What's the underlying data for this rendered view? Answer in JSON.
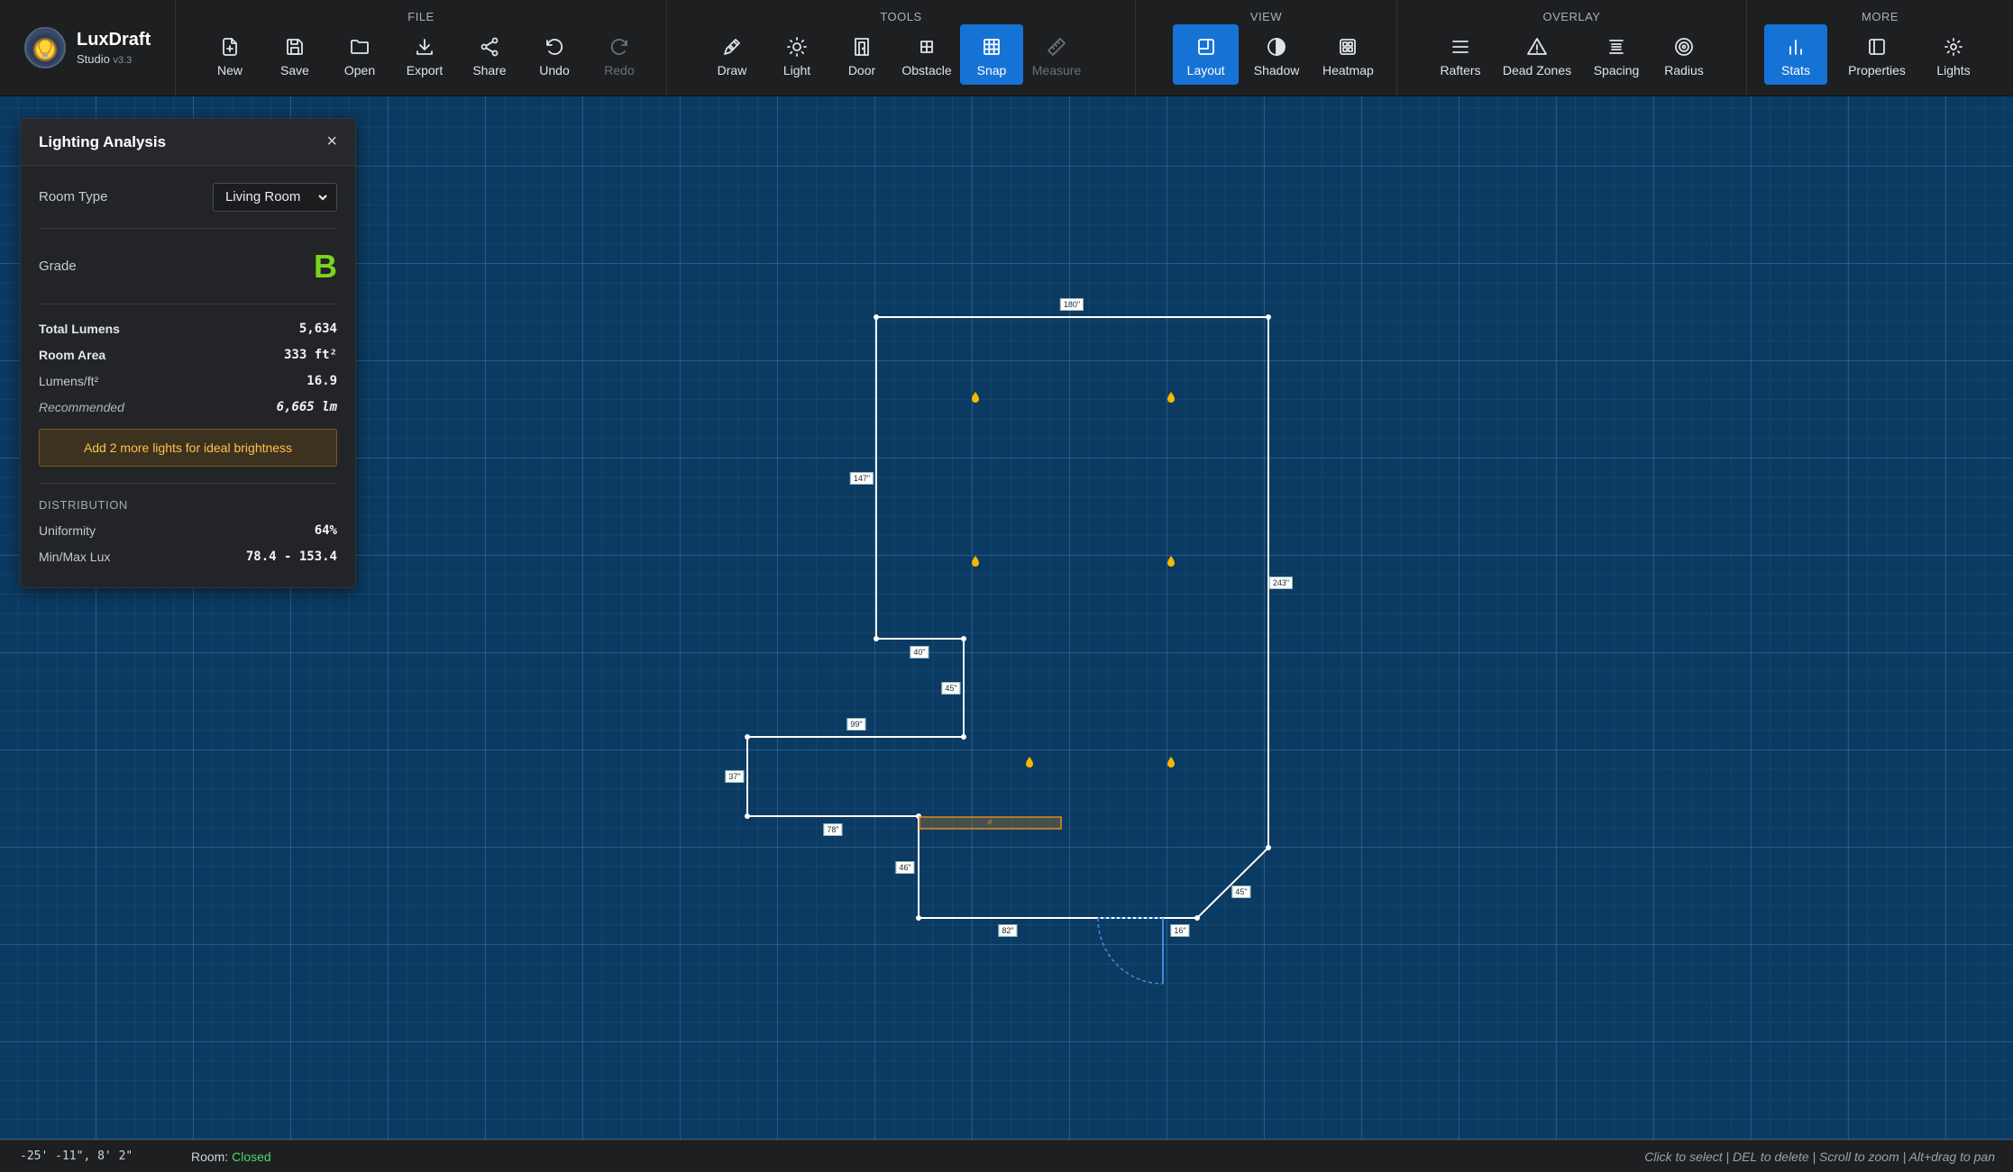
{
  "app": {
    "name": "LuxDraft",
    "subtitle": "Studio",
    "version": "v3.3"
  },
  "toolbar": {
    "groups": [
      {
        "label": "FILE",
        "buttons": [
          {
            "label": "New",
            "icon": "file-plus-icon",
            "state": "normal"
          },
          {
            "label": "Save",
            "icon": "save-icon",
            "state": "normal"
          },
          {
            "label": "Open",
            "icon": "folder-icon",
            "state": "normal"
          },
          {
            "label": "Export",
            "icon": "download-icon",
            "state": "normal"
          },
          {
            "label": "Share",
            "icon": "share-icon",
            "state": "normal"
          },
          {
            "label": "Undo",
            "icon": "undo-icon",
            "state": "normal"
          },
          {
            "label": "Redo",
            "icon": "redo-icon",
            "state": "disabled"
          }
        ]
      },
      {
        "label": "TOOLS",
        "buttons": [
          {
            "label": "Draw",
            "icon": "pen-icon",
            "state": "normal"
          },
          {
            "label": "Light",
            "icon": "sun-icon",
            "state": "normal"
          },
          {
            "label": "Door",
            "icon": "door-icon",
            "state": "normal"
          },
          {
            "label": "Obstacle",
            "icon": "obstacle-icon",
            "state": "normal"
          },
          {
            "label": "Snap",
            "icon": "grid-icon",
            "state": "active"
          },
          {
            "label": "Measure",
            "icon": "ruler-icon",
            "state": "disabled"
          }
        ]
      },
      {
        "label": "VIEW",
        "buttons": [
          {
            "label": "Layout",
            "icon": "layout-icon",
            "state": "active"
          },
          {
            "label": "Shadow",
            "icon": "shadow-icon",
            "state": "normal"
          },
          {
            "label": "Heatmap",
            "icon": "heatmap-icon",
            "state": "normal"
          }
        ]
      },
      {
        "label": "OVERLAY",
        "buttons": [
          {
            "label": "Rafters",
            "icon": "rafters-icon",
            "state": "normal"
          },
          {
            "label": "Dead Zones",
            "icon": "warning-icon",
            "state": "normal"
          },
          {
            "label": "Spacing",
            "icon": "spacing-icon",
            "state": "normal"
          },
          {
            "label": "Radius",
            "icon": "radius-icon",
            "state": "normal"
          }
        ]
      },
      {
        "label": "MORE",
        "buttons": [
          {
            "label": "Stats",
            "icon": "bar-chart-icon",
            "state": "active"
          },
          {
            "label": "Properties",
            "icon": "panel-icon",
            "state": "normal"
          },
          {
            "label": "Lights",
            "icon": "lights-icon",
            "state": "normal"
          }
        ]
      }
    ]
  },
  "panel": {
    "title": "Lighting Analysis",
    "close": "×",
    "room_type_label": "Room Type",
    "room_type_value": "Living Room",
    "grade_label": "Grade",
    "grade_value": "B",
    "stats": [
      {
        "key": "Total Lumens",
        "value": "5,634",
        "style": "bold"
      },
      {
        "key": "Room Area",
        "value": "333 ft²",
        "style": "bold"
      },
      {
        "key": "Lumens/ft²",
        "value": "16.9",
        "style": "normal"
      },
      {
        "key": "Recommended",
        "value": "6,665 lm",
        "style": "italic"
      }
    ],
    "advice": "Add 2 more lights for ideal brightness",
    "distribution_title": "DISTRIBUTION",
    "distribution": [
      {
        "key": "Uniformity",
        "value": "64%"
      },
      {
        "key": "Min/Max Lux",
        "value": "78.4 - 153.4"
      }
    ]
  },
  "plan": {
    "dimensions": [
      "180\"",
      "147\"",
      "243\"",
      "40\"",
      "45\"",
      "99\"",
      "37\"",
      "78\"",
      "46\"",
      "82\"",
      "16\"",
      "45\""
    ],
    "obstacle_label": "#",
    "light_count": 6,
    "colors": {
      "wall": "#ffffff",
      "light": "#f5b800",
      "obstacle": "#e08a1e",
      "door": "#3d8bdb"
    }
  },
  "status": {
    "coords": "-25' -11\", 8' 2\"",
    "room_label": "Room:",
    "room_state": "Closed",
    "hints": "Click to select | DEL to delete | Scroll to zoom | Alt+drag to pan"
  }
}
